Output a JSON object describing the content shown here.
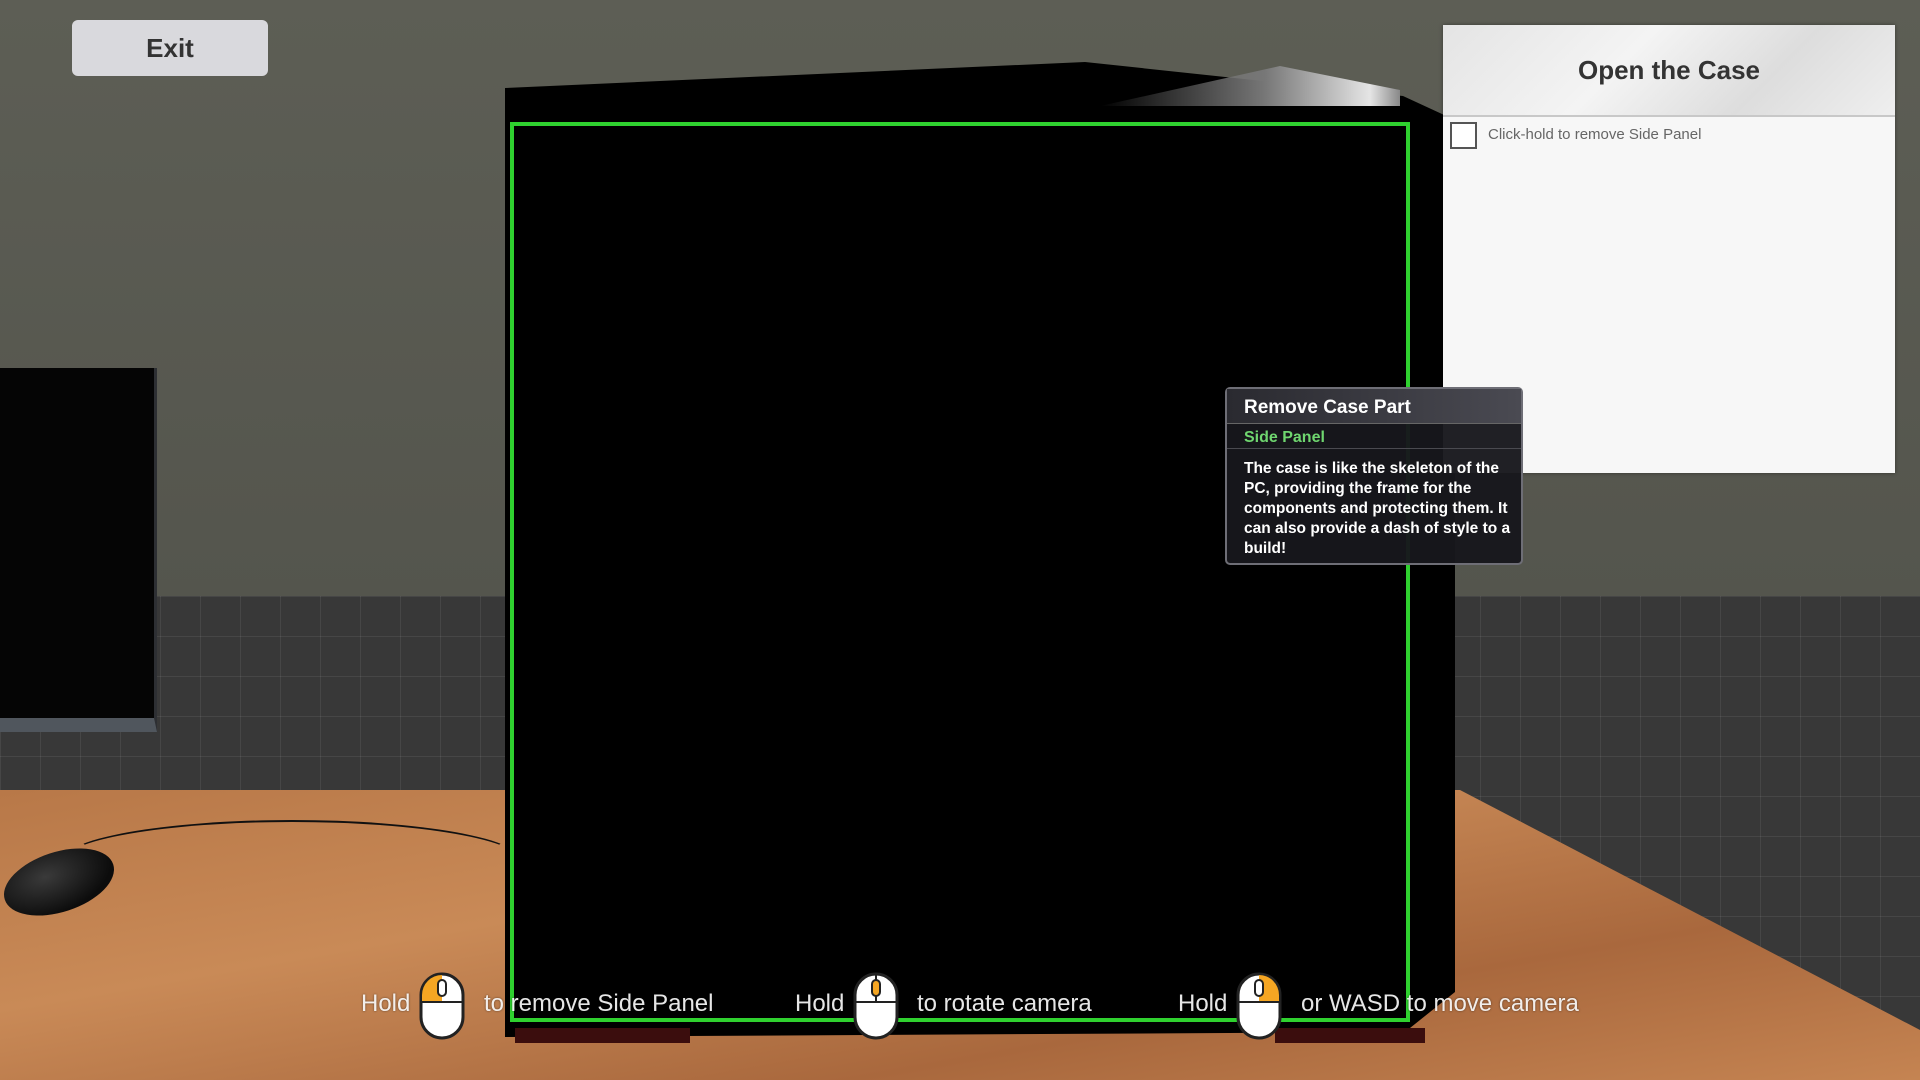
{
  "exit_button": {
    "label": "Exit"
  },
  "task_panel": {
    "title": "Open the Case",
    "tasks": [
      {
        "label": "Click-hold to remove Side Panel",
        "checked": false
      }
    ]
  },
  "tooltip": {
    "title": "Remove Case Part",
    "subtitle": "Side Panel",
    "description": "The case is like the skeleton of the PC, providing the frame for the components and protecting them. It can also provide a dash of style to a build!"
  },
  "controls": [
    {
      "prefix": "Hold",
      "button": "left-mouse-button",
      "action": "to remove Side Panel"
    },
    {
      "prefix": "Hold",
      "button": "middle-mouse-button",
      "action": "to rotate camera"
    },
    {
      "prefix": "Hold",
      "button": "right-mouse-button",
      "action": "or WASD to move camera"
    }
  ],
  "colors": {
    "selection_outline": "#2fd12f",
    "subtitle_green": "#6fd66f",
    "mouse_button_highlight": "#f5a623"
  }
}
